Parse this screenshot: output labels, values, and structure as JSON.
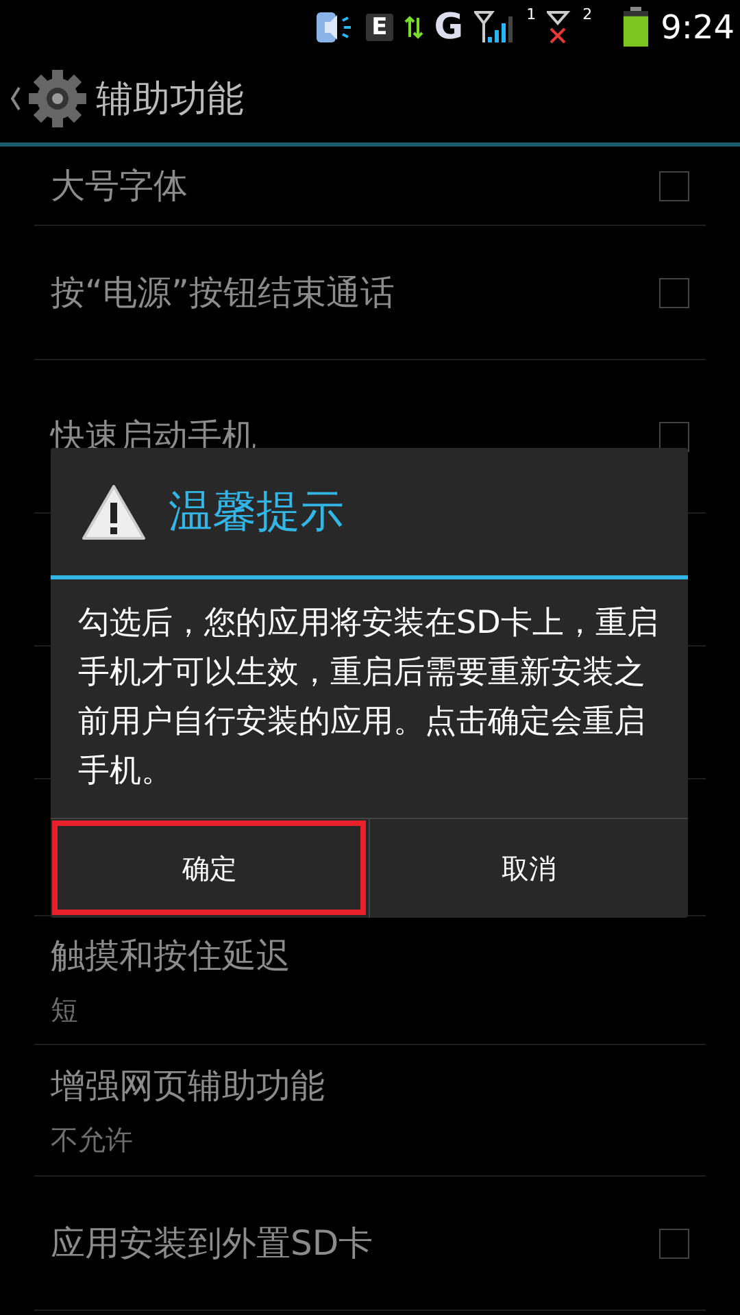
{
  "status_bar": {
    "data_type": "E",
    "sim1_type": "G",
    "sim1_index": "1",
    "sim2_index": "2",
    "battery": {
      "level": 0.85
    },
    "time": "9:24"
  },
  "header": {
    "title": "辅助功能"
  },
  "settings": [
    {
      "kind": "checkbox",
      "title": "大号字体",
      "checked": false
    },
    {
      "kind": "checkbox",
      "title": "按“电源”按钮结束通话",
      "checked": false
    },
    {
      "kind": "checkbox",
      "title": "快速启动手机",
      "checked": false
    },
    {
      "kind": "hidden"
    },
    {
      "kind": "hidden"
    },
    {
      "kind": "hidden"
    },
    {
      "kind": "choice",
      "title": "触摸和按住延迟",
      "summary": "短"
    },
    {
      "kind": "choice",
      "title": "增强网页辅助功能",
      "summary": "不允许"
    },
    {
      "kind": "checkbox",
      "title": "应用安装到外置SD卡",
      "checked": false
    }
  ],
  "dialog": {
    "title": "温馨提示",
    "message": "勾选后，您的应用将安装在SD卡上，重启手机才可以生效，重启后需要重新安装之前用户自行安装的应用。点击确定会重启手机。",
    "buttons": [
      {
        "label": "确定",
        "highlighted": true
      },
      {
        "label": "取消",
        "highlighted": false
      }
    ]
  }
}
